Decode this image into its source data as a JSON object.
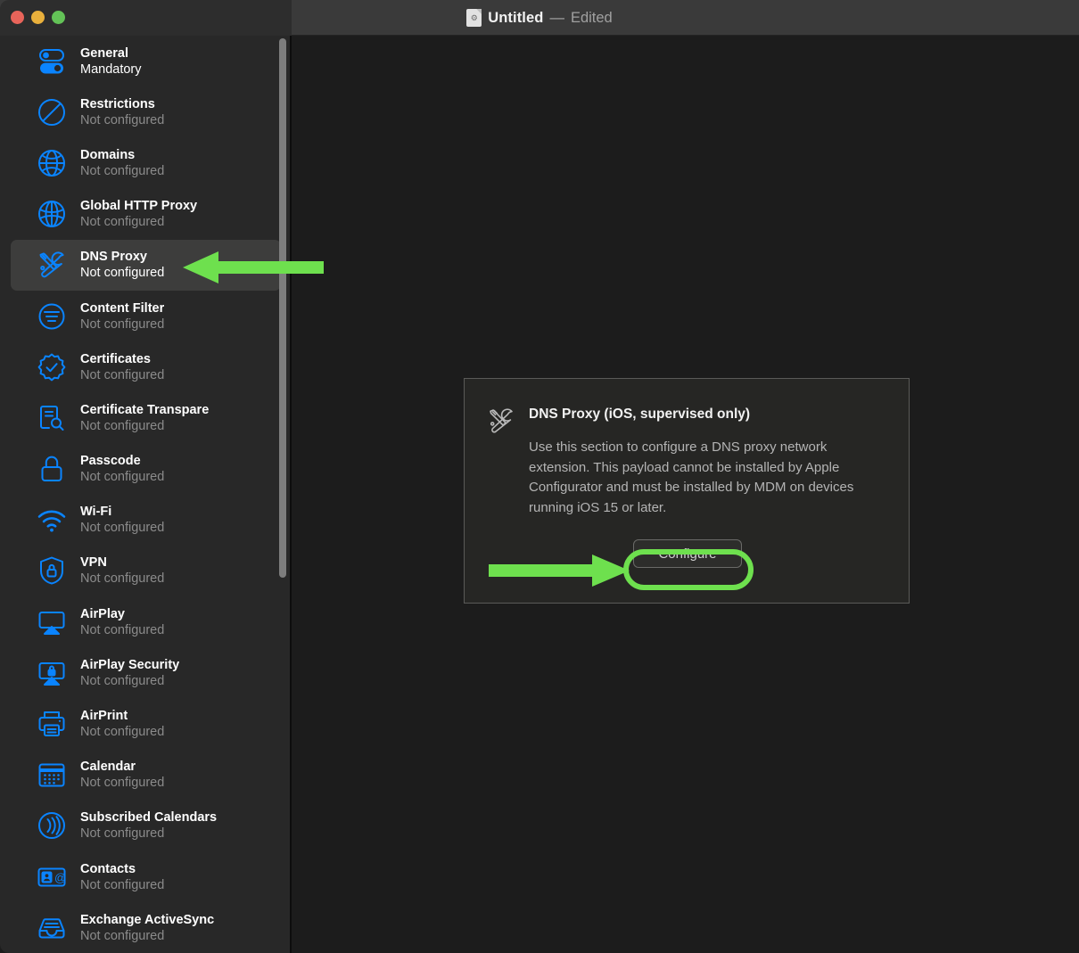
{
  "window": {
    "title_name": "Untitled",
    "title_separator": "—",
    "title_state": "Edited",
    "doc_icon": "document-icon",
    "traffic_lights": [
      {
        "name": "close-button",
        "color": "#e8645a"
      },
      {
        "name": "minimize-button",
        "color": "#e9b03c"
      },
      {
        "name": "zoom-button",
        "color": "#63c257"
      }
    ]
  },
  "sidebar": {
    "items": [
      {
        "label": "General",
        "status": "Mandatory",
        "icon": "toggles-icon",
        "selected": false,
        "mandatory": true
      },
      {
        "label": "Restrictions",
        "status": "Not configured",
        "icon": "no-entry-icon",
        "selected": false
      },
      {
        "label": "Domains",
        "status": "Not configured",
        "icon": "globe-icon",
        "selected": false
      },
      {
        "label": "Global HTTP Proxy",
        "status": "Not configured",
        "icon": "globe-proxy-icon",
        "selected": false
      },
      {
        "label": "DNS Proxy",
        "status": "Not configured",
        "icon": "tools-icon",
        "selected": true
      },
      {
        "label": "Content Filter",
        "status": "Not configured",
        "icon": "filter-lines-icon",
        "selected": false
      },
      {
        "label": "Certificates",
        "status": "Not configured",
        "icon": "certificate-badge-icon",
        "selected": false
      },
      {
        "label": "Certificate Transpare",
        "status": "Not configured",
        "icon": "document-search-icon",
        "selected": false
      },
      {
        "label": "Passcode",
        "status": "Not configured",
        "icon": "lock-icon",
        "selected": false
      },
      {
        "label": "Wi-Fi",
        "status": "Not configured",
        "icon": "wifi-icon",
        "selected": false
      },
      {
        "label": "VPN",
        "status": "Not configured",
        "icon": "shield-lock-icon",
        "selected": false
      },
      {
        "label": "AirPlay",
        "status": "Not configured",
        "icon": "airplay-icon",
        "selected": false
      },
      {
        "label": "AirPlay Security",
        "status": "Not configured",
        "icon": "airplay-security-icon",
        "selected": false
      },
      {
        "label": "AirPrint",
        "status": "Not configured",
        "icon": "printer-icon",
        "selected": false
      },
      {
        "label": "Calendar",
        "status": "Not configured",
        "icon": "calendar-icon",
        "selected": false
      },
      {
        "label": "Subscribed Calendars",
        "status": "Not configured",
        "icon": "broadcast-icon",
        "selected": false
      },
      {
        "label": "Contacts",
        "status": "Not configured",
        "icon": "contact-card-icon",
        "selected": false
      },
      {
        "label": "Exchange ActiveSync",
        "status": "Not configured",
        "icon": "inbox-icon",
        "selected": false
      }
    ],
    "scrollbar": {
      "name": "sidebar-scrollbar"
    }
  },
  "main": {
    "card": {
      "icon": "tools-icon",
      "title": "DNS Proxy (iOS, supervised only)",
      "description": "Use this section to configure a DNS proxy network extension. This payload cannot be installed by Apple Configurator and must be installed by MDM on devices running iOS 15 or later.",
      "configure_label": "Configure"
    }
  },
  "annotations": {
    "highlight_color": "#6ee04e",
    "sidebar_arrow": "arrow-pointing-left-at-dns-proxy",
    "configure_arrow": "arrow-pointing-right-at-configure-button",
    "configure_ring": "highlight-ring-around-configure-button"
  },
  "colors": {
    "accent_blue": "#0a84ff",
    "sidebar_bg": "#282828",
    "main_bg": "#1c1c1c",
    "card_bg": "#262624",
    "highlight_green": "#6ee04e"
  }
}
